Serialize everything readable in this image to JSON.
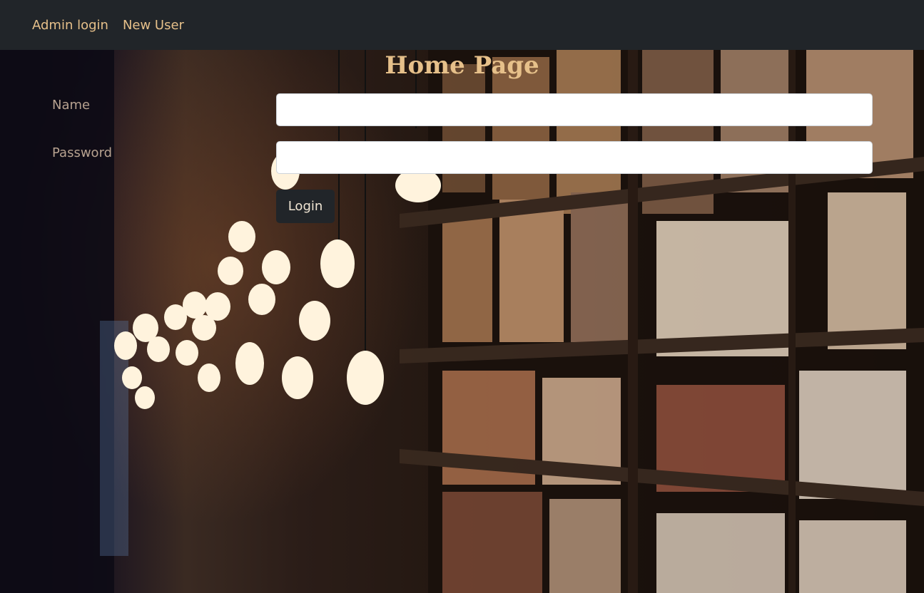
{
  "navbar": {
    "links": [
      {
        "label": "Admin login"
      },
      {
        "label": "New User"
      }
    ]
  },
  "page": {
    "title": "Home Page"
  },
  "form": {
    "name_label": "Name",
    "name_value": "",
    "password_label": "Password",
    "password_value": "",
    "login_label": "Login"
  },
  "colors": {
    "navbar_bg": "#212529",
    "accent_text": "#e6c08a",
    "button_bg": "#212529"
  },
  "background": {
    "description_icon": "library-bookshelves-photo"
  }
}
